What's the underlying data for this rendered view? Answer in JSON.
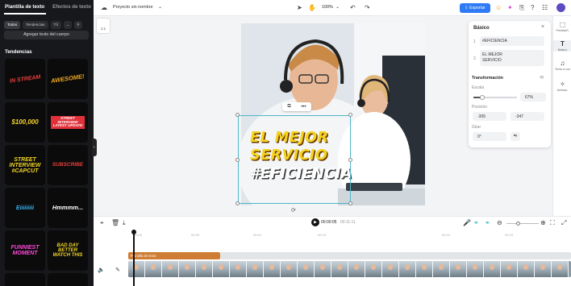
{
  "left_panel": {
    "tab_active": "Plantilla de texto",
    "tab_inactive": "Efectos de texto",
    "filters": [
      "Todos",
      "Tendencias",
      "Tít"
    ],
    "add_body_label": "Agregar texto del cuerpo",
    "section_title": "Tendencias",
    "tiles": [
      {
        "text": "IN STREAM",
        "color": "#e8413b"
      },
      {
        "text": "AWESOME!",
        "color": "#f2a81d"
      },
      {
        "text": "$100,000",
        "color": "#f6d22b"
      },
      {
        "text": "STREET INTERVIEW LATEST UPDATE",
        "color": "#e0313a"
      },
      {
        "text": "STREET INTERVIEW #CAPCUT",
        "color": "#f3d625"
      },
      {
        "text": "SUBSCRIBE",
        "color": "#e8413b"
      },
      {
        "text": "Eiiiiiiiii",
        "color": "#3ab4f2"
      },
      {
        "text": "Hmmmm...",
        "color": "#ffffff"
      },
      {
        "text": "FUNNIEST MOMENT",
        "color": "#ff48d8"
      },
      {
        "text": "BAD DAY BETTER WATCH THIS",
        "color": "#f3d625"
      }
    ]
  },
  "topbar": {
    "project_name": "Proyecto sin nombre",
    "zoom": "100%",
    "export_label": "Exportar"
  },
  "canvas": {
    "ratio_label": "1:1",
    "caption_line1": "EL MEJOR",
    "caption_line2": "SERVICIO",
    "caption_line3": "#EFICIENCIA"
  },
  "properties": {
    "title": "Básico",
    "text1": "#EFICIENCIA",
    "text2_line1": "EL MEJOR",
    "text2_line2": "SERVICIO",
    "transform_label": "Transformación",
    "scale_label": "Escala",
    "scale_value": "67%",
    "scale_fraction": 0.2,
    "position_label": "Posición",
    "pos_x": "-305",
    "pos_y": "-347",
    "rotate_label": "Girar",
    "rotate_value": "0°"
  },
  "rail": {
    "items": [
      "Prediseñ.",
      "Básico",
      "Texto a voz",
      "Animac."
    ]
  },
  "timeline": {
    "current_time": "00:00:05",
    "total_time": "00:11:11",
    "ticks": [
      "00:00",
      "00:05",
      "00:10",
      "00:15",
      "00:10",
      "00:15"
    ],
    "text_track_label": "Plantilla de texto"
  },
  "colors": {
    "accent": "#2f7af5",
    "caption_yellow": "#f5d21e",
    "selection": "#4fb6c8",
    "text_track": "#cf7d34"
  }
}
